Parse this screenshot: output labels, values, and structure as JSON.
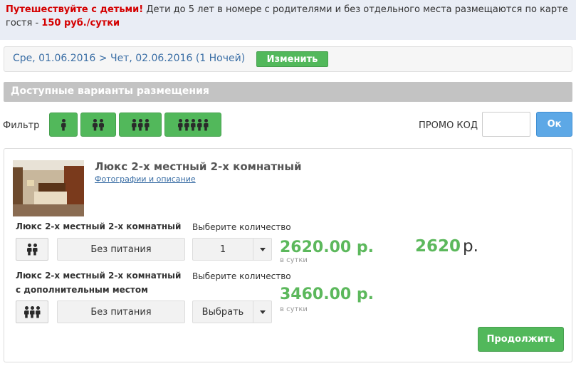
{
  "promo_banner": {
    "highlight": "Путешествуйте с детьми!",
    "text_before_price": " Дети до 5 лет в номере с родителями и без отдельного места размещаются по карте гостя - ",
    "price": "150 руб./сутки"
  },
  "dates": {
    "text": "Сре, 01.06.2016 > Чет, 02.06.2016 (1 Ночей)",
    "change_label": "Изменить"
  },
  "section": {
    "title": "Доступные варианты размещения"
  },
  "filter": {
    "label": "Фильтр",
    "buttons": [
      {
        "persons": 1
      },
      {
        "persons": 2
      },
      {
        "persons": 3
      },
      {
        "persons": 5
      }
    ]
  },
  "promo": {
    "label": "ПРОМО КОД",
    "value": "",
    "ok_label": "Ок"
  },
  "room": {
    "title": "Люкс 2-х местный 2-х комнатный",
    "link": "Фотографии и описание",
    "rates": [
      {
        "name": "Люкс 2-х местный 2-х комнатный",
        "qty_label": "Выберите количество",
        "persons": 2,
        "meal": "Без питания",
        "qty": "1",
        "price": "2620.00 р.",
        "per_day": "в сутки"
      },
      {
        "name": "Люкс 2-х местный 2-х комнатный с дополнительным местом",
        "qty_label": "Выберите количество",
        "persons": 3,
        "meal": "Без питания",
        "qty": "Выбрать",
        "price": "3460.00 р.",
        "per_day": "в сутки"
      }
    ],
    "total": "2620",
    "currency": "р."
  },
  "continue_label": "Продолжить",
  "colors": {
    "green": "#52b85b",
    "blue_link": "#3a6ea5",
    "red": "#d40000",
    "ok_blue": "#5da8e6"
  }
}
